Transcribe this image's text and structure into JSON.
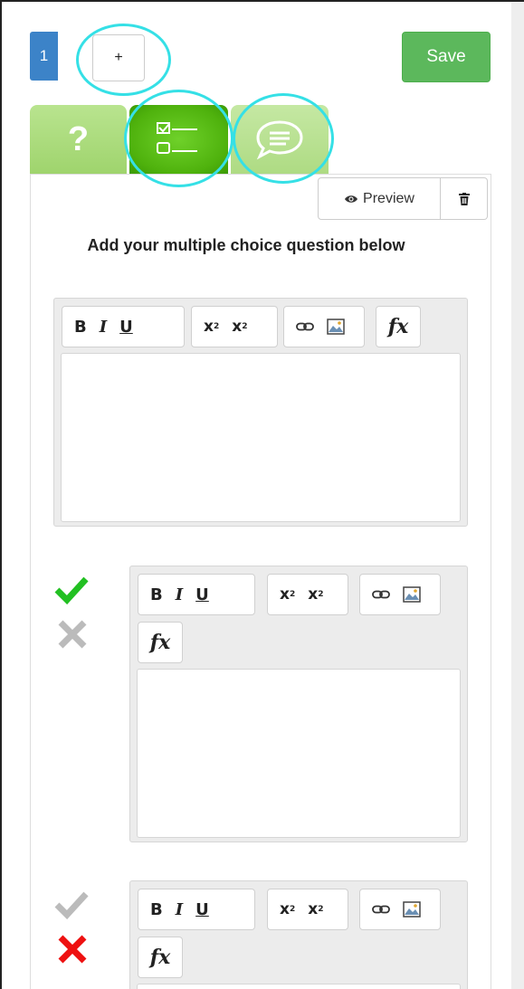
{
  "topbar": {
    "page_number": "1",
    "add_page_label": "+",
    "save_label": "Save"
  },
  "tabs": [
    {
      "name": "question",
      "label": "?",
      "icon": "question-icon"
    },
    {
      "name": "multiple-choice",
      "icon": "checklist-icon",
      "active": true
    },
    {
      "name": "feedback",
      "icon": "speech-bubble-icon"
    }
  ],
  "panel": {
    "preview_label": "Preview",
    "instructions": "Add your multiple choice question below"
  },
  "toolbar": {
    "bold": "B",
    "italic": "I",
    "underline": "U",
    "superscript_base": "x",
    "superscript_exp": "2",
    "subscript_base": "x",
    "subscript_sub": "2",
    "formula": "fx"
  },
  "answers": [
    {
      "correct_marker": "active",
      "incorrect_marker": "inactive"
    },
    {
      "correct_marker": "inactive",
      "incorrect_marker": "active"
    }
  ],
  "colors": {
    "primary_blue": "#3c83c8",
    "save_green": "#5cb85c",
    "tab_green_active": "#4fb20d",
    "highlight_cyan": "#35e0e6",
    "check_green": "#22c022",
    "cross_red": "#ee1111",
    "inactive_gray": "#bbbbbb"
  }
}
